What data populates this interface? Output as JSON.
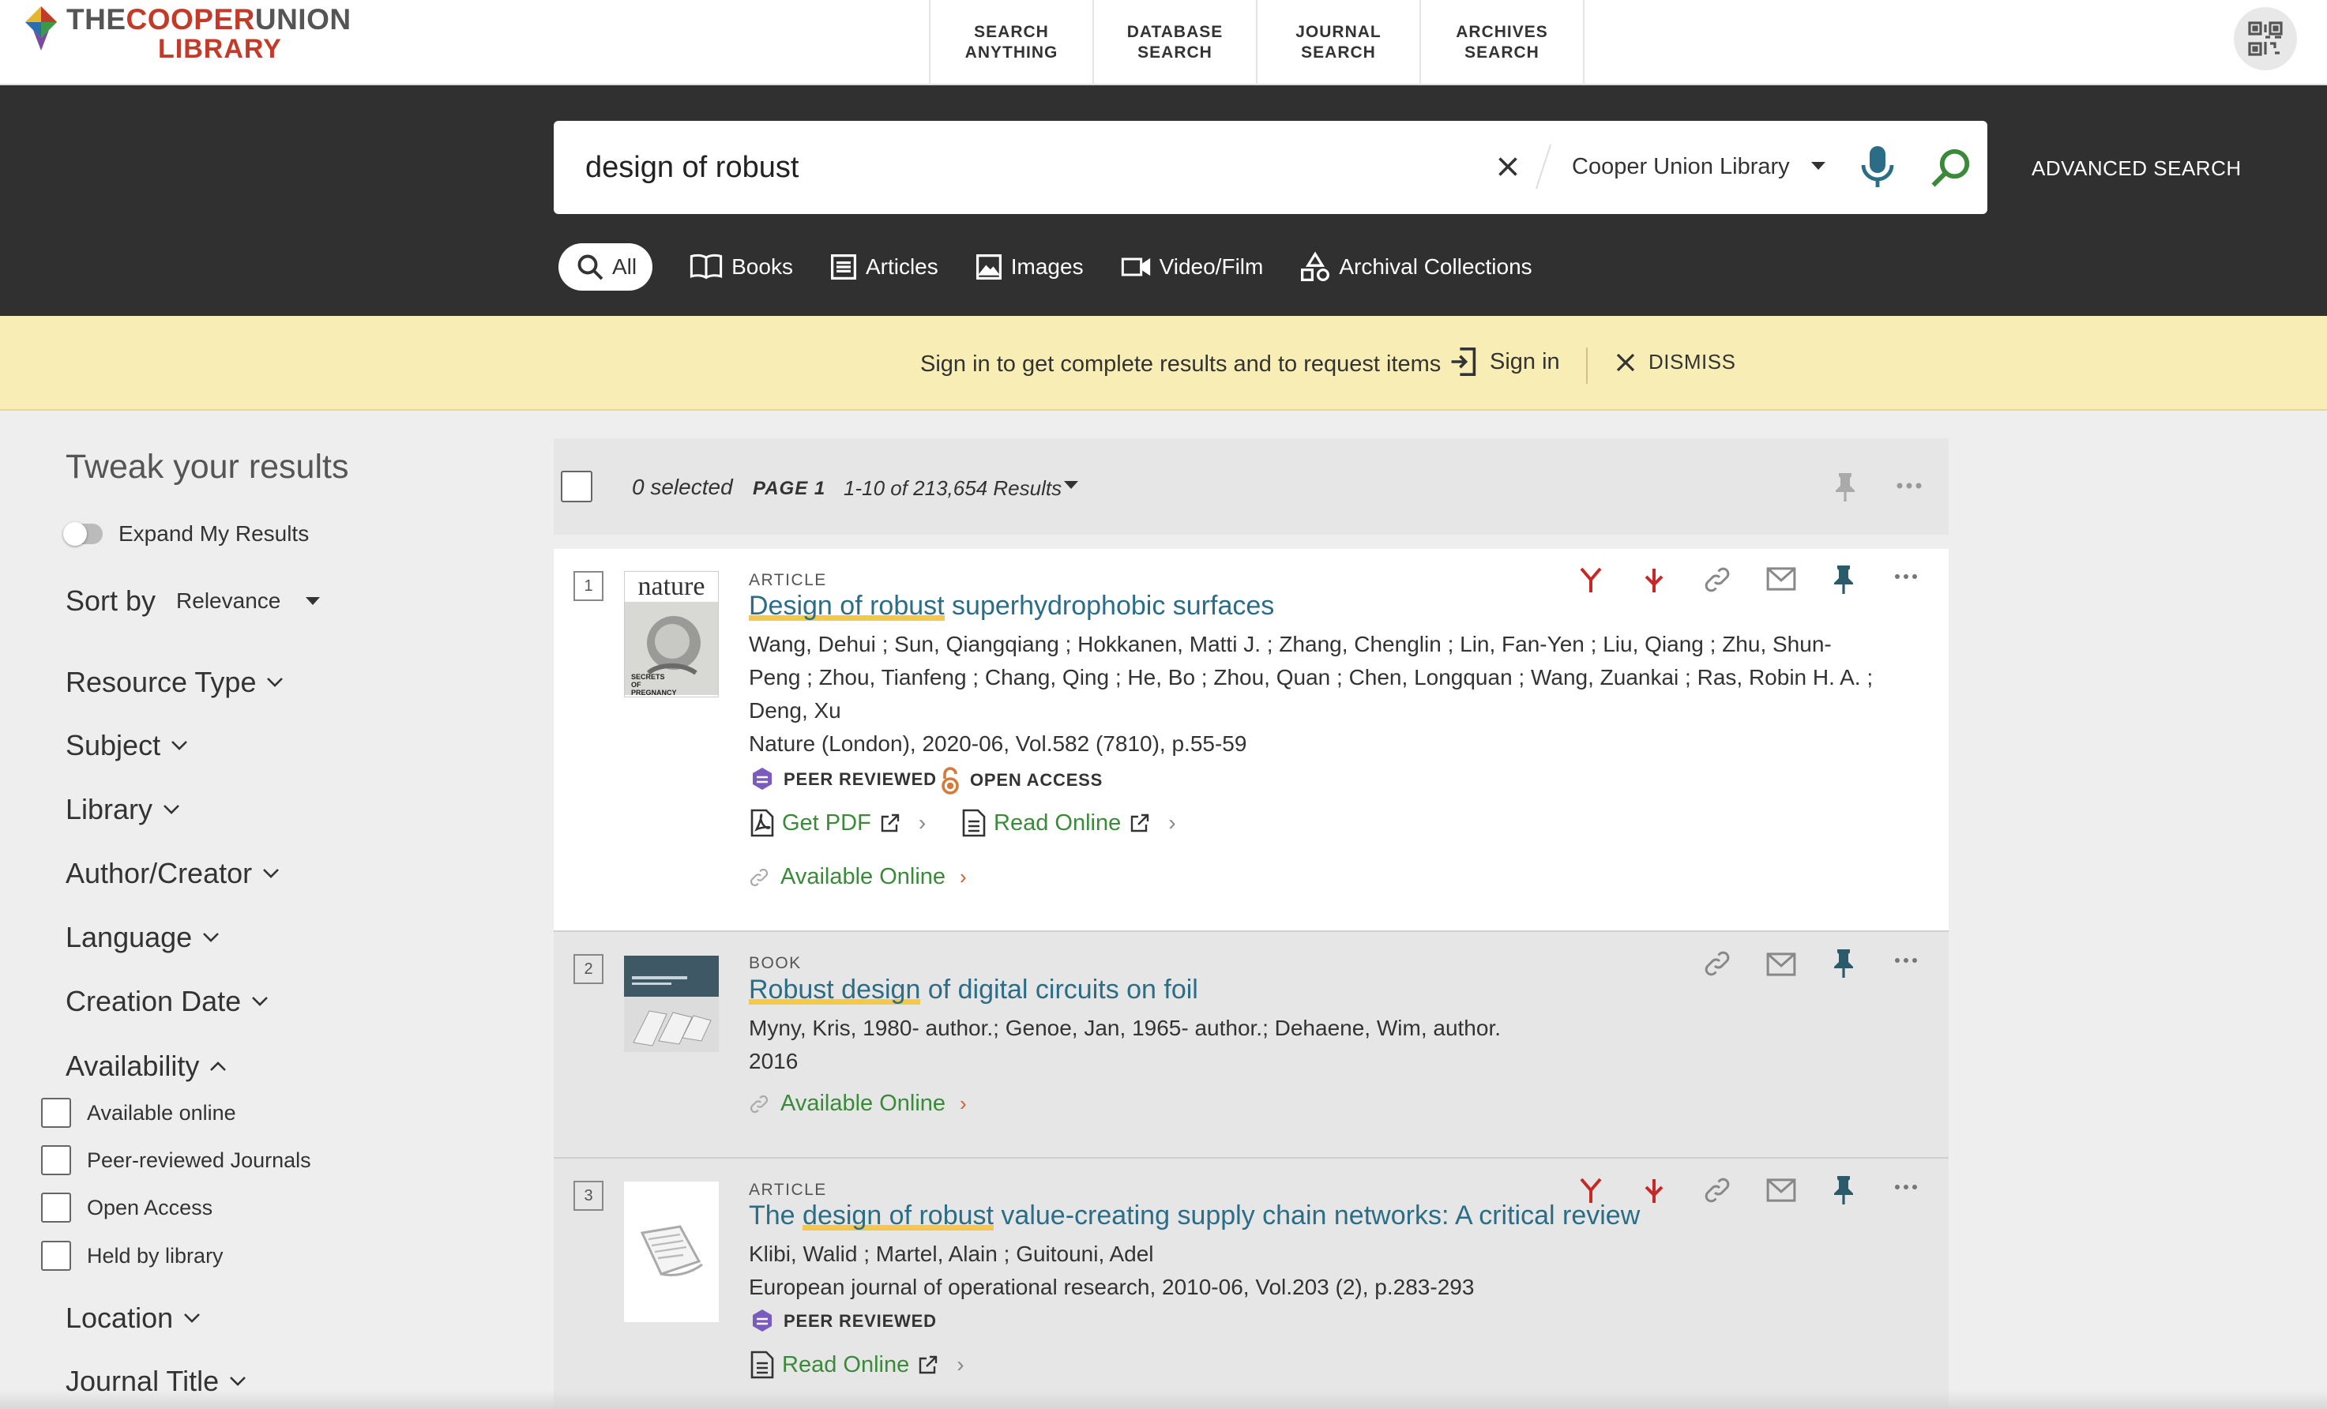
{
  "brand": {
    "line1_a": "THE",
    "line1_b": "COOPER",
    "line1_c": "UNION",
    "line2": "LIBRARY"
  },
  "topnav": [
    "SEARCH\nANYTHING",
    "DATABASE\nSEARCH",
    "JOURNAL\nSEARCH",
    "ARCHIVES\nSEARCH"
  ],
  "search": {
    "query": "design of robust",
    "scope": "Cooper Union Library",
    "advanced": "ADVANCED SEARCH"
  },
  "resource_tabs": [
    "All",
    "Books",
    "Articles",
    "Images",
    "Video/Film",
    "Archival Collections"
  ],
  "banner": {
    "message": "Sign in to get complete results and to request items",
    "signin": "Sign in",
    "dismiss": "DISMISS"
  },
  "sidebar": {
    "title": "Tweak your results",
    "expand": "Expand My Results",
    "sort_label": "Sort by",
    "sort_value": "Relevance",
    "facets": [
      "Resource Type",
      "Subject",
      "Library",
      "Author/Creator",
      "Language",
      "Creation Date",
      "Availability"
    ],
    "availability_options": [
      "Available online",
      "Peer-reviewed Journals",
      "Open Access",
      "Held by library"
    ],
    "facets_after": [
      "Location",
      "Journal Title"
    ]
  },
  "results_header": {
    "selected": "0 selected",
    "page": "PAGE 1",
    "count": "1-10 of 213,654 Results"
  },
  "results": [
    {
      "num": "1",
      "type": "ARTICLE",
      "title_hl": "Design of robust",
      "title_rest": " superhydrophobic surfaces",
      "authors_l1": "Wang, Dehui ; Sun, Qiangqiang ; Hokkanen, Matti J. ; Zhang, Chenglin ; Lin, Fan-Yen ; Liu, Qiang ; Zhu, Shun-",
      "authors_l2": "Peng ; Zhou, Tianfeng ; Chang, Qing ; He, Bo ; Zhou, Quan ; Chen, Longquan ; Wang, Zuankai ; Ras, Robin H. A. ;",
      "authors_l3": "Deng, Xu",
      "source": "Nature (London), 2020-06, Vol.582 (7810), p.55-59",
      "peer": "PEER REVIEWED",
      "open": "OPEN ACCESS",
      "get_pdf": "Get PDF",
      "read_online": "Read Online",
      "available": "Available Online",
      "thumb_word": "nature",
      "thumb_caption": "SECRETS OF PREGNANCY"
    },
    {
      "num": "2",
      "type": "BOOK",
      "title_hl": "Robust design",
      "title_rest": " of digital circuits on foil",
      "authors_l1": "Myny, Kris, 1980- author.; Genoe, Jan, 1965- author.; Dehaene, Wim, author.",
      "date": "2016",
      "available": "Available Online"
    },
    {
      "num": "3",
      "type": "ARTICLE",
      "title_pre": "The ",
      "title_hl": "design of robust",
      "title_rest": " value-creating supply chain networks: A critical review",
      "authors_l1": "Klibi, Walid ; Martel, Alain ; Guitouni, Adel",
      "source": "European journal of operational research, 2010-06, Vol.203 (2), p.283-293",
      "peer": "PEER REVIEWED",
      "read_online": "Read Online"
    }
  ],
  "colors": {
    "accent_green": "#3a8a3a",
    "title_blue": "#2b6d87",
    "brand_red": "#c23a28",
    "banner": "#f8eeb5"
  }
}
